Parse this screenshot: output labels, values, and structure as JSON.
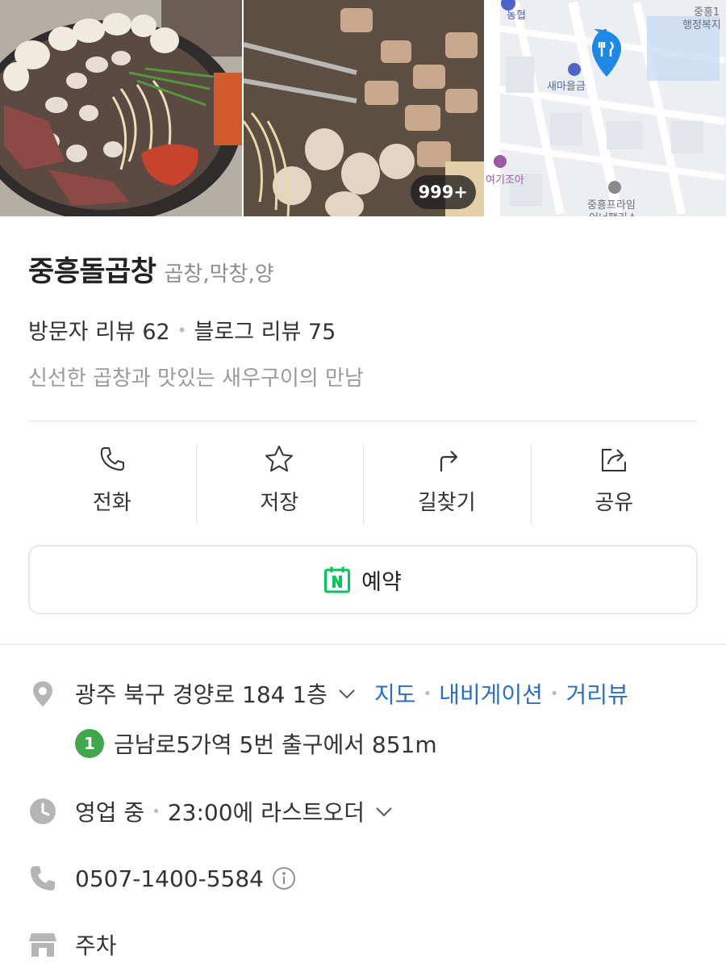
{
  "gallery": {
    "photo_count": "999+",
    "map_labels": {
      "bank": "농협",
      "top_right_1": "중흥1",
      "top_right_2": "행정복지",
      "saemaeul": "새마을금",
      "cafe": "여기조아",
      "apartment_1": "중흥프라임",
      "apartment_2": "어너팰리스"
    }
  },
  "place": {
    "name": "중흥돌곱창",
    "category": "곱창,막창,양",
    "visitor_review": "방문자 리뷰 62",
    "blog_review": "블로그 리뷰 75",
    "description": "신선한 곱창과 맛있는 새우구이의 만남"
  },
  "actions": {
    "call": "전화",
    "save": "저장",
    "directions": "길찾기",
    "share": "공유"
  },
  "reserve": {
    "label": "예약"
  },
  "details": {
    "address": "광주 북구 경양로 184 1층",
    "map_link": "지도",
    "navigation_link": "내비게이션",
    "streetview_link": "거리뷰",
    "subway_line": "1",
    "subway_info": "금남로5가역 5번 출구에서 851m",
    "status": "영업 중",
    "last_order": "23:00에 라스트오더",
    "phone": "0507-1400-5584",
    "parking": "주차"
  },
  "colors": {
    "link": "#2b6ec9",
    "subway_line1": "#3ea84a",
    "naver_green": "#03c75a",
    "map_pin": "#1e88e5"
  },
  "icons": {
    "call": "phone-icon",
    "save": "star-icon",
    "directions": "turn-right-arrow-icon",
    "share": "share-icon",
    "reserve": "naver-booking-icon",
    "address": "location-pin-icon",
    "hours": "clock-icon",
    "phone": "phone-icon",
    "parking": "store-icon"
  }
}
